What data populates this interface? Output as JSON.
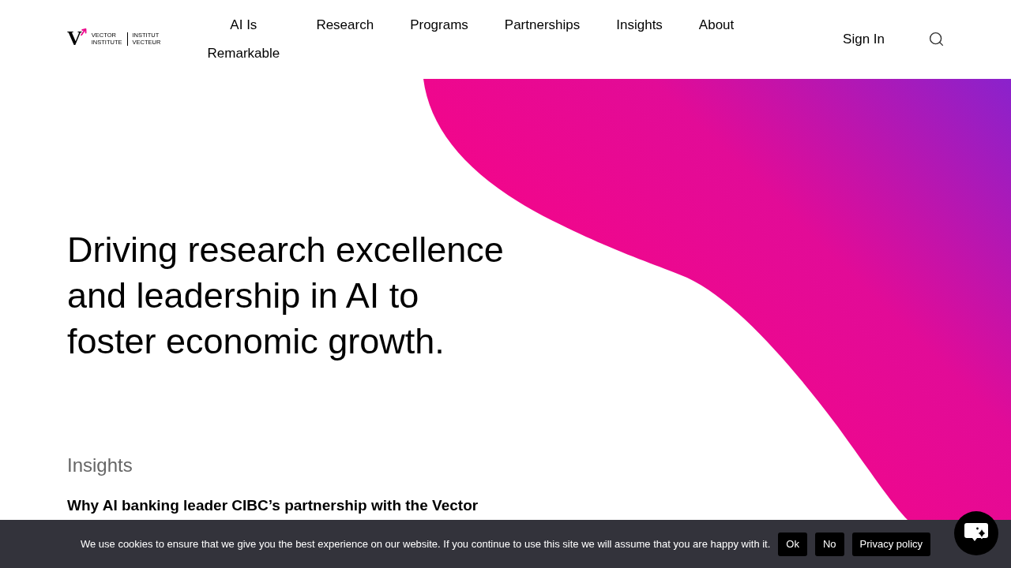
{
  "header": {
    "logo": {
      "mark": "V",
      "wordmark_en": [
        "VECTOR",
        "INSTITUTE"
      ],
      "wordmark_fr": [
        "INSTITUT",
        "VECTEUR"
      ]
    },
    "nav": [
      {
        "label": "AI Is Remarkable"
      },
      {
        "label": "Research"
      },
      {
        "label": "Programs"
      },
      {
        "label": "Partnerships"
      },
      {
        "label": "Insights"
      },
      {
        "label": "About"
      }
    ],
    "sign_in": "Sign In"
  },
  "hero": {
    "headline": "Driving research excellence and leadership in AI to foster economic growth.",
    "section_label": "Insights",
    "article_title": "Why AI banking leader CIBC’s partnership with the Vector"
  },
  "cookie_banner": {
    "message": "We use cookies to ensure that we give you the best experience on our website. If you continue to use this site we will assume that you are happy with it.",
    "buttons": [
      "Ok",
      "No",
      "Privacy policy"
    ]
  }
}
